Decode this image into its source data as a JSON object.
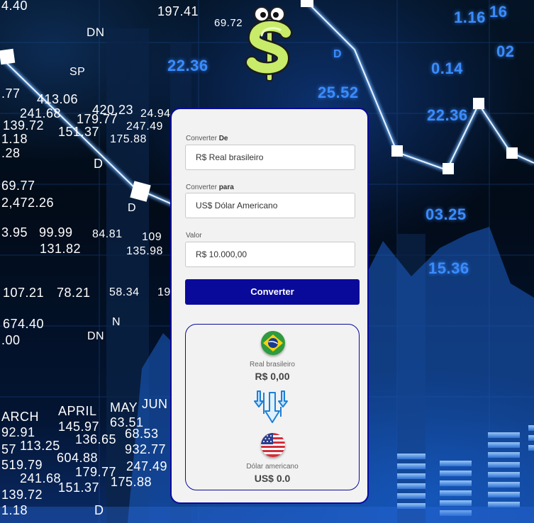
{
  "background_numbers": [
    {
      "text": "4.40"
    },
    {
      "text": "197.41"
    },
    {
      "text": "69.72"
    },
    {
      "text": "DN"
    },
    {
      "text": "SP"
    },
    {
      "text": ".77"
    },
    {
      "text": "413.06"
    },
    {
      "text": "420.23"
    },
    {
      "text": "24.94"
    },
    {
      "text": "241.68"
    },
    {
      "text": "179.77"
    },
    {
      "text": "247.49"
    },
    {
      "text": "139.72"
    },
    {
      "text": "151.37"
    },
    {
      "text": "175.88"
    },
    {
      "text": "1.18"
    },
    {
      "text": ".28"
    },
    {
      "text": "D"
    },
    {
      "text": "69.77"
    },
    {
      "text": "2,472.26"
    },
    {
      "text": "D"
    },
    {
      "text": "3.95"
    },
    {
      "text": "99.99"
    },
    {
      "text": "84.81"
    },
    {
      "text": "109"
    },
    {
      "text": "131.82"
    },
    {
      "text": "135.98"
    },
    {
      "text": "107.21"
    },
    {
      "text": "78.21"
    },
    {
      "text": "58.34"
    },
    {
      "text": "19"
    },
    {
      "text": "N"
    },
    {
      "text": "674.40"
    },
    {
      "text": "DN"
    },
    {
      "text": ".00"
    },
    {
      "text": "ARCH"
    },
    {
      "text": "APRIL"
    },
    {
      "text": "MAY"
    },
    {
      "text": "JUN"
    },
    {
      "text": "92.91"
    },
    {
      "text": "145.97"
    },
    {
      "text": "63.51"
    },
    {
      "text": "57"
    },
    {
      "text": "113.25"
    },
    {
      "text": "136.65"
    },
    {
      "text": "68.53"
    },
    {
      "text": "519.79"
    },
    {
      "text": "604.88"
    },
    {
      "text": "932.77"
    },
    {
      "text": "241.68"
    },
    {
      "text": "179.77"
    },
    {
      "text": "247.49"
    },
    {
      "text": "139.72"
    },
    {
      "text": "151.37"
    },
    {
      "text": "175.88"
    },
    {
      "text": "1.18"
    },
    {
      "text": "D"
    },
    {
      "text": "16"
    },
    {
      "text": "D"
    },
    {
      "text": "1.16"
    },
    {
      "text": "0.14"
    },
    {
      "text": "22.36"
    },
    {
      "text": "25.52"
    },
    {
      "text": "22.36"
    },
    {
      "text": "03.25"
    },
    {
      "text": "15.36"
    },
    {
      "text": "02"
    }
  ],
  "form": {
    "from_label_prefix": "Converter ",
    "from_label_bold": "De",
    "from_value": "R$ Real brasileiro",
    "to_label_prefix": "Converter ",
    "to_label_bold": "para",
    "to_value": "US$ Dólar Americano",
    "amount_label": "Valor",
    "amount_value": "R$ 10.000,00",
    "convert_button": "Converter"
  },
  "result": {
    "from_name": "Real brasileiro",
    "from_value": "R$ 0,00",
    "to_name": "Dólar americano",
    "to_value": "US$ 0.0"
  },
  "colors": {
    "accent": "#0a0a9a",
    "card_bg": "#f2f2f2"
  },
  "icons": {
    "mascot": "dollar-sign-mascot",
    "from_flag": "brazil-flag-icon",
    "to_flag": "usa-flag-icon",
    "arrows": "down-arrows-icon"
  }
}
